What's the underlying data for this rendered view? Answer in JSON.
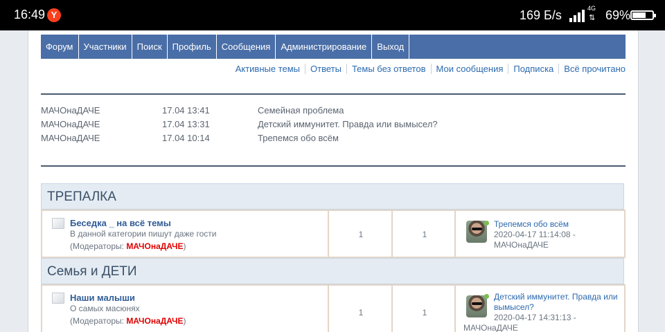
{
  "status_bar": {
    "time": "16:49",
    "browser_icon": "Y",
    "net_speed": "169 Б/s",
    "network_type": "4G",
    "battery": "69%",
    "battery_level": 0.69
  },
  "nav": {
    "items": [
      "Форум",
      "Участники",
      "Поиск",
      "Профиль",
      "Сообщения",
      "Администрирование",
      "Выход"
    ]
  },
  "quick_links": [
    "Активные темы",
    "Ответы",
    "Темы без ответов",
    "Мои сообщения",
    "Подписка",
    "Всё прочитано"
  ],
  "recent_posts": [
    {
      "author": "МАЧОнаДАЧЕ",
      "date": "17.04 13:41",
      "topic": "Семейная проблема"
    },
    {
      "author": "МАЧОнаДАЧЕ",
      "date": "17.04 13:31",
      "topic": "Детский иммунитет. Правда или вымысел?"
    },
    {
      "author": "МАЧОнаДАЧЕ",
      "date": "17.04 10:14",
      "topic": "Трепемся обо всём"
    }
  ],
  "categories": [
    {
      "title": "ТРЕПАЛКА",
      "forum": {
        "title": "Беседка _ на всё темы",
        "description": "В данной категории пишут даже гости",
        "mods_prefix": "(Модераторы: ",
        "mods_name": "МАЧОнаДАЧЕ",
        "mods_suffix": ")",
        "topics": "1",
        "posts": "1",
        "last_topic": "Трепемся обо всём",
        "last_date": "2020-04-17 11:14:08 -",
        "last_author": "МАЧОнаДАЧЕ"
      }
    },
    {
      "title": "Семья и ДЕТИ",
      "forum": {
        "title": "Наши малыши",
        "description": "О самых масюнях",
        "mods_prefix": "(Модераторы: ",
        "mods_name": "МАЧОнаДАЧЕ",
        "mods_suffix": ")",
        "topics": "1",
        "posts": "1",
        "last_topic_line1": "Детский иммунитет. Правда или",
        "last_topic_line2": "вымысел?",
        "last_date": "2020-04-17 14:31:13 -",
        "last_author": "МАЧОнаДАЧЕ"
      }
    }
  ],
  "colors": {
    "nav_bg": "#4a6ea7",
    "link": "#2b6aaf",
    "moderator": "#e00000",
    "category_bg": "#e4ebf2"
  }
}
